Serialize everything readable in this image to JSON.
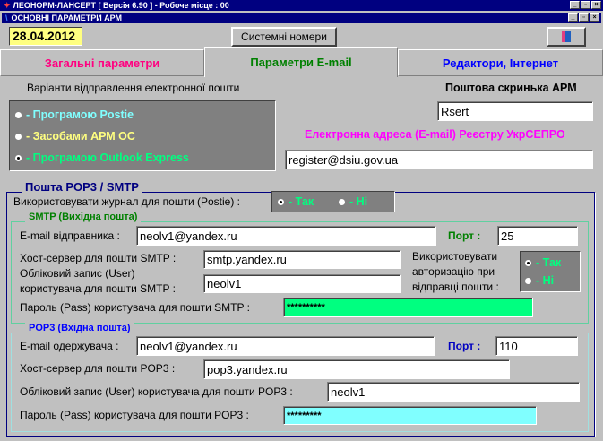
{
  "app_title": "ЛЕОНОРМ-ЛАНСЕРТ  [ Версія 6.90 ]  -  Робоче місце : 00",
  "window_title": "ОСНОВНІ  ПАРАМЕТРИ  АРМ",
  "toolbar": {
    "date": "28.04.2012",
    "system_numbers_label": "Системні номери"
  },
  "tabs": [
    {
      "label": "Загальні параметри",
      "color": "#ff0080"
    },
    {
      "label": "Параметри  E-mail",
      "color": "#008000",
      "active": true
    },
    {
      "label": "Редактори, Інтернет",
      "color": "#0000ff"
    }
  ],
  "send": {
    "title": "Варіанти відправлення електронної пошти",
    "options": [
      {
        "label": "- Програмою  Postie",
        "color": "#80ffff",
        "selected": false
      },
      {
        "label": "- Засобами  АРМ ОС",
        "color": "#ffff80",
        "selected": false
      },
      {
        "label": "- Програмою  Outlook Express",
        "color": "#00ff80",
        "selected": true
      }
    ]
  },
  "mailbox": {
    "label": "Поштова скринька  АРМ",
    "value": "Rsert"
  },
  "registry": {
    "label": "Електронна адреса (E-mail) Реєстру УкрСЕПРО",
    "value": "register@dsiu.gov.ua"
  },
  "mail": {
    "legend": "Пошта  POP3 / SMTP",
    "journal_label": "Використовувати журнал для пошти  (Postie) :",
    "journal_yes": "- Так",
    "journal_no": "- Ні",
    "journal_selected": "yes"
  },
  "smtp": {
    "legend": "SMTP (Вихідна пошта)",
    "sender_label": "E-mail відправника :",
    "sender": "neolv1@yandex.ru",
    "port_label": "Порт :",
    "port": "25",
    "host_label": "Хост-сервер  для пошти  SMTP :",
    "host": "smtp.yandex.ru",
    "user_label_1": "Обліковий запис (User)",
    "user_label_2": "користувача для пошти  SMTP :",
    "user": "neolv1",
    "auth_label_1": "Використовувати",
    "auth_label_2": "авторизацію при",
    "auth_label_3": "відправці пошти :",
    "auth_yes": "- Так",
    "auth_no": "- Ні",
    "auth_selected": "yes",
    "pass_label": "Пароль (Pass) користувача для пошти  SMTP :",
    "pass": "**********"
  },
  "pop3": {
    "legend": "POP3 (Вхідна пошта)",
    "recipient_label": "E-mail одержувача :",
    "recipient": "neolv1@yandex.ru",
    "port_label": "Порт :",
    "port": "110",
    "host_label": "Хост-сервер для пошти  POP3 :",
    "host": "pop3.yandex.ru",
    "user_label": "Обліковий запис (User) користувача для пошти  POP3 :",
    "user": "neolv1",
    "pass_label": "Пароль (Pass) користувача для пошти  POP3 :",
    "pass": "*********"
  }
}
